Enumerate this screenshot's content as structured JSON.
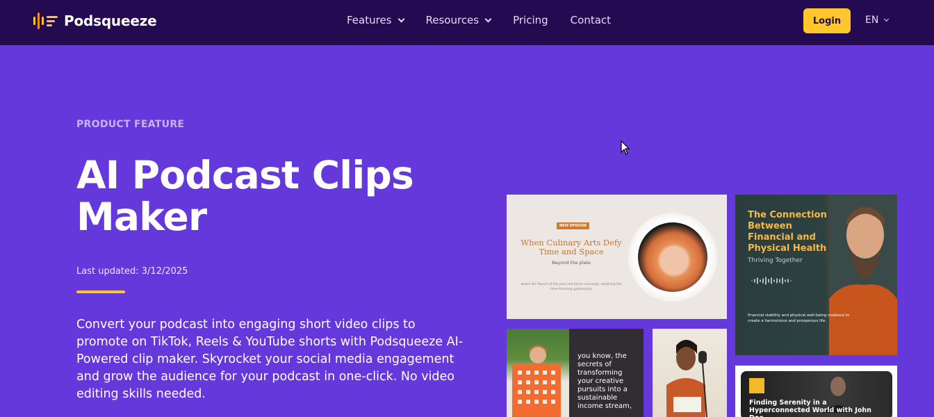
{
  "nav": {
    "brand": "Podsqueeze",
    "links": [
      "Features",
      "Resources",
      "Pricing",
      "Contact"
    ],
    "login_label": "Login",
    "language": "EN"
  },
  "hero": {
    "eyebrow": "PRODUCT FEATURE",
    "title": "AI Podcast Clips Maker",
    "updated": "Last updated: 3/12/2025",
    "description": "Convert your podcast into engaging short video clips to promote on TikTok, Reels & YouTube shorts with Podsqueeze AI-Powered clip maker. Skyrocket your social media engagement and grow the audience for your podcast in one-click. No video editing skills needed."
  },
  "cards": {
    "culinary": {
      "badge": "NEW EPISODE",
      "title": "When Culinary Arts Defy Time and Space",
      "subtitle": "Beyond the plate",
      "footer": "where the flavors of the past and future converge, exploring the time-traveling gastronomy"
    },
    "financial": {
      "title": "The Connection Between Financial and Physical Health",
      "subtitle": "Thriving Together",
      "footer": "financial stability and physical well-being coalesce to create a harmonious and prosperous life."
    },
    "creative": {
      "text": "you know, the secrets of transforming your creative pursuits into a sustainable income stream,"
    },
    "serenity": {
      "title": "Finding Serenity in a Hyperconnected World with John Doe"
    }
  },
  "colors": {
    "hero_bg": "#6538dc",
    "nav_bg": "#240a50",
    "accent": "#ffc72c"
  }
}
